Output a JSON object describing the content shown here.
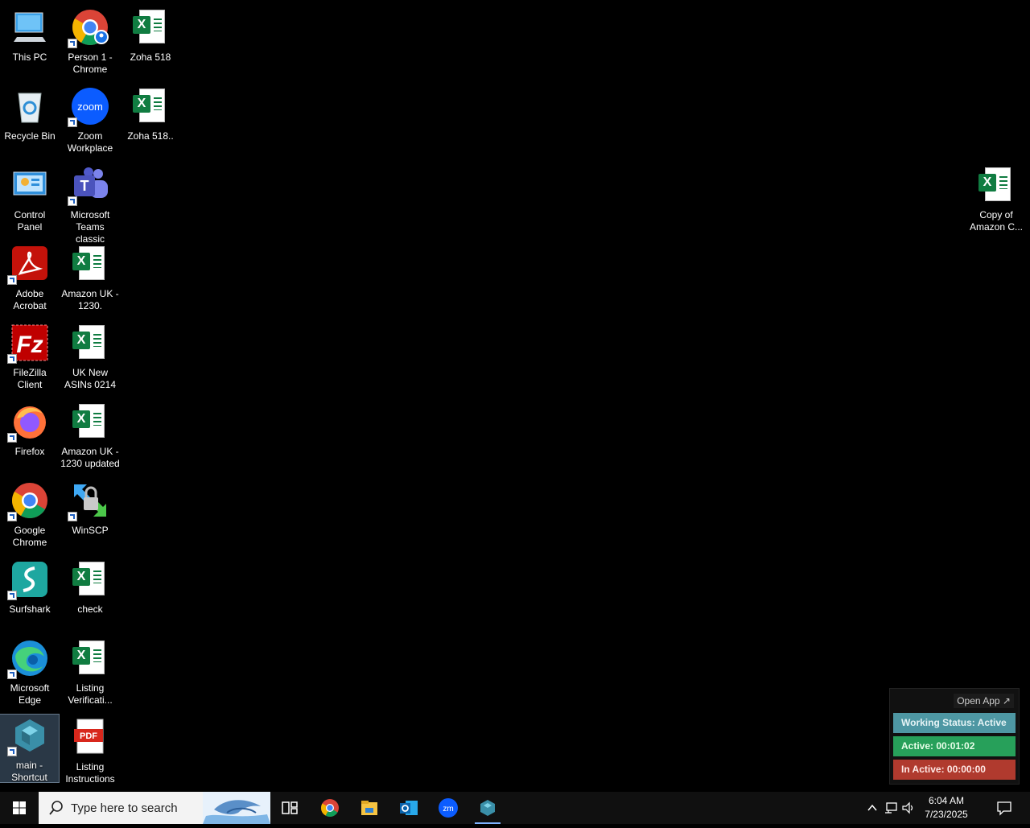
{
  "desktop": {
    "icons": [
      {
        "label": "This PC"
      },
      {
        "label": "Recycle Bin"
      },
      {
        "label": "Control\nPanel"
      },
      {
        "label": "Adobe\nAcrobat"
      },
      {
        "label": "FileZilla\nClient"
      },
      {
        "label": "Firefox"
      },
      {
        "label": "Google\nChrome"
      },
      {
        "label": "Surfshark"
      },
      {
        "label": "Microsoft\nEdge"
      },
      {
        "label": "main -\nShortcut"
      },
      {
        "label": "Person 1 -\nChrome"
      },
      {
        "label": "Zoom\nWorkplace"
      },
      {
        "label": "Microsoft\nTeams classic"
      },
      {
        "label": "Amazon UK -\n1230."
      },
      {
        "label": "UK New\nASINs 0214"
      },
      {
        "label": "Amazon UK -\n1230 updated"
      },
      {
        "label": "WinSCP"
      },
      {
        "label": "check"
      },
      {
        "label": "Listing\nVerificati..."
      },
      {
        "label": "Listing\nInstructions"
      },
      {
        "label": "Zoha 518"
      },
      {
        "label": "Zoha 518.."
      },
      {
        "label": "Copy of\nAmazon C..."
      }
    ],
    "icon_glyphs": {
      "zoom_logo": "zoom",
      "pdf_logo": "PDF",
      "teams_logo": "T",
      "excel_logo": "X"
    }
  },
  "status_widget": {
    "open_app": "Open App ↗",
    "working_status": "Working Status: Active",
    "active": "Active: 00:01:02",
    "inactive": "In Active: 00:00:00",
    "colors": {
      "working": "#4e97a3",
      "active": "#27a05a",
      "inactive": "#b03a2e"
    }
  },
  "taskbar": {
    "search_placeholder": "Type here to search",
    "apps": [
      "task-view-icon",
      "chrome-icon",
      "file-explorer-icon",
      "outlook-icon",
      "zoom-icon",
      "main-app-icon"
    ],
    "clock_time": "6:04 AM",
    "clock_date": "7/23/2025"
  }
}
